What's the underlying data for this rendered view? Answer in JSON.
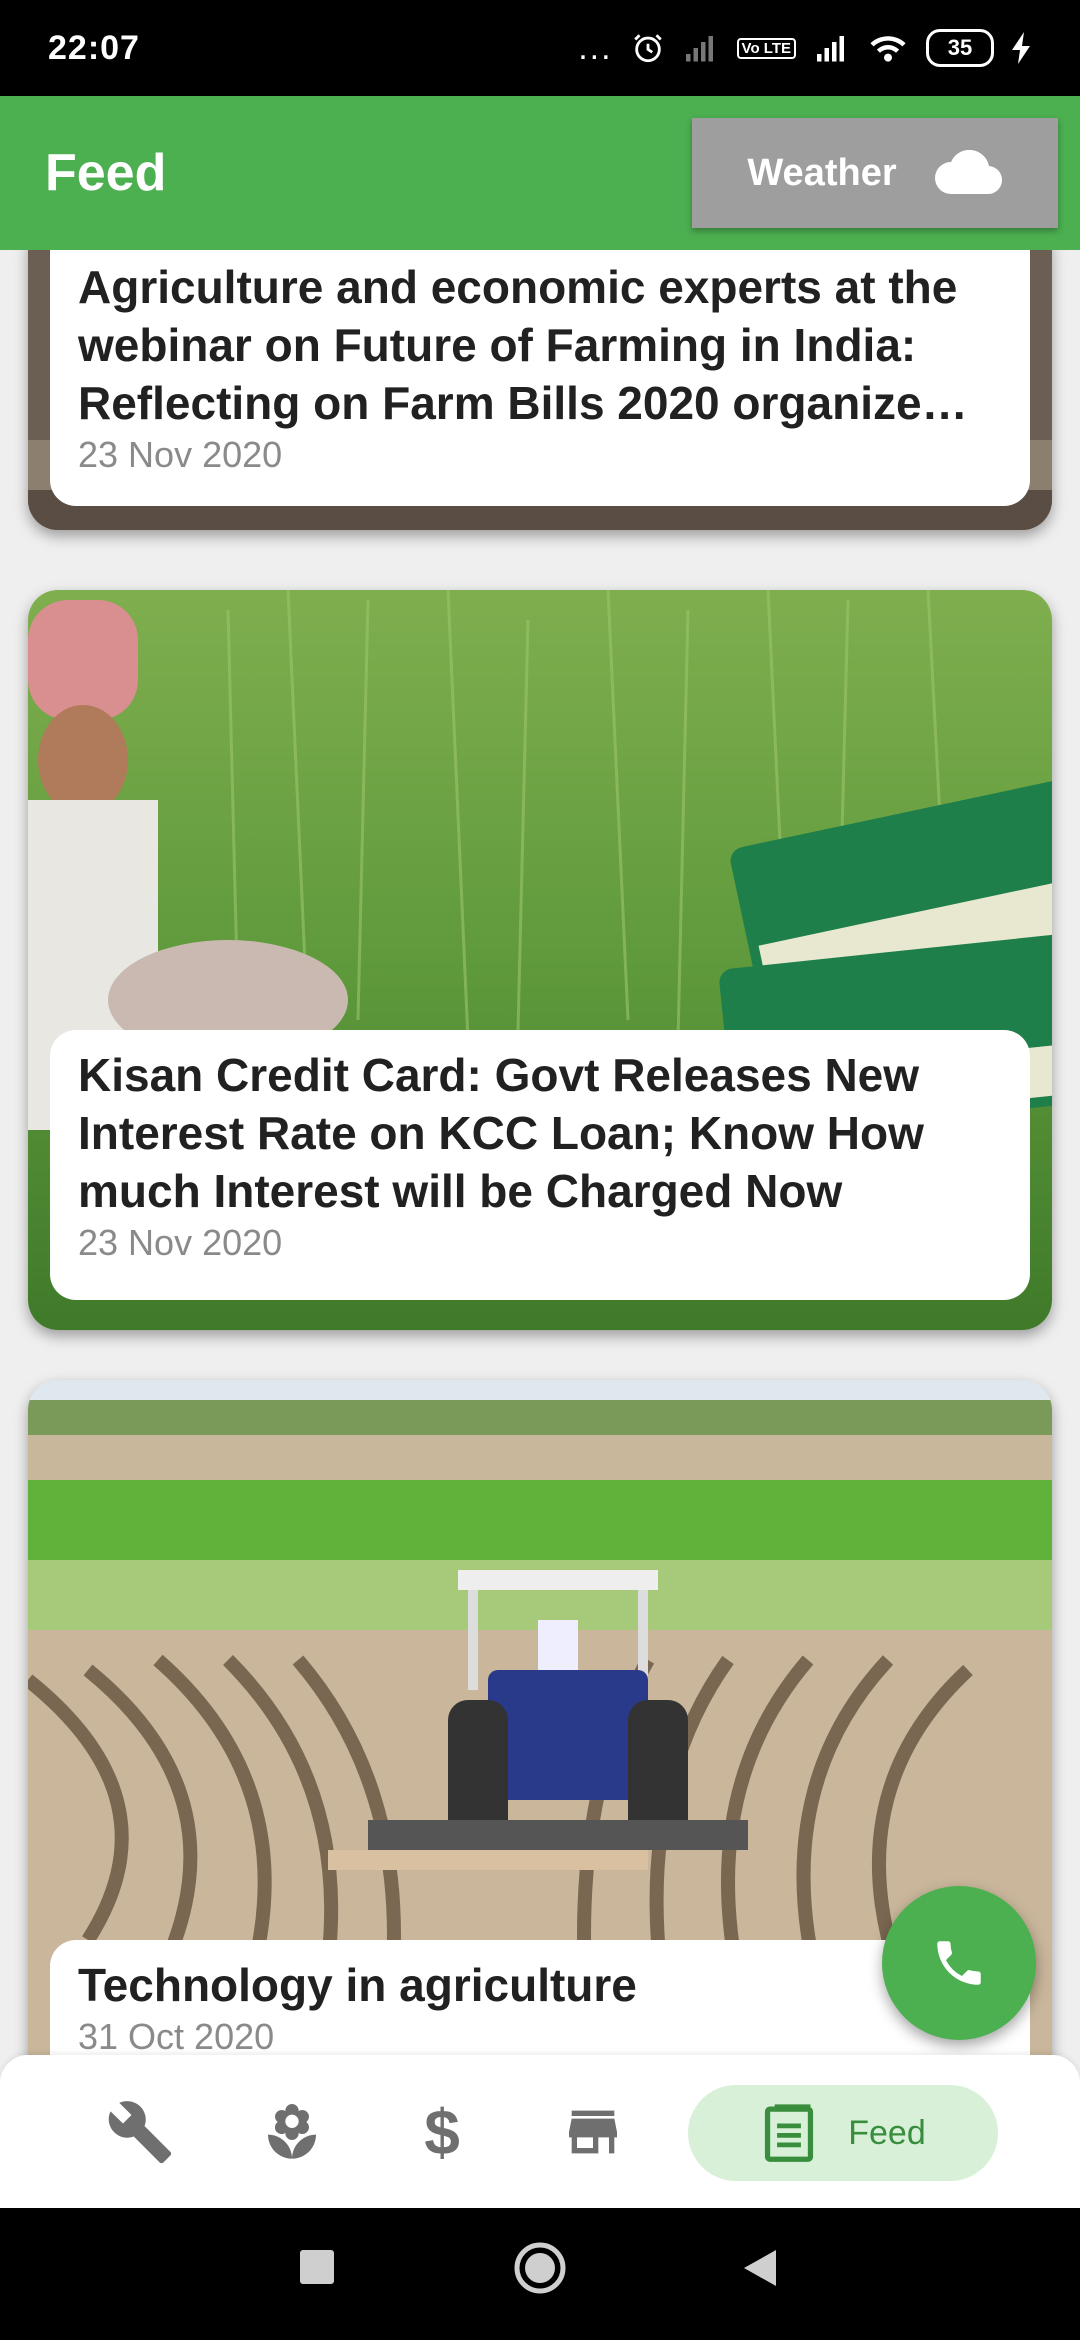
{
  "status_bar": {
    "time": "22:07",
    "dots": "...",
    "lte_label": "Vo LTE",
    "battery": "35"
  },
  "app_bar": {
    "title": "Feed",
    "weather_label": "Weather"
  },
  "feed": {
    "items": [
      {
        "headline": "Agriculture and economic experts at the webinar on Future of Farming in India: Reflecting on Farm Bills 2020 organize…",
        "date": "23 Nov 2020"
      },
      {
        "headline": "Kisan Credit Card: Govt Releases New Interest Rate on KCC Loan; Know How much Interest will be Charged Now",
        "date": "23 Nov 2020"
      },
      {
        "headline": "Technology in agriculture",
        "date": "31 Oct 2020"
      }
    ]
  },
  "bottom_nav": {
    "items": [
      {
        "icon": "wrench-icon"
      },
      {
        "icon": "flower-icon"
      },
      {
        "icon": "dollar-icon",
        "symbol": "$"
      },
      {
        "icon": "store-icon"
      },
      {
        "icon": "feed-icon",
        "label": "Feed",
        "active": true
      }
    ]
  },
  "colors": {
    "primary": "#4caf50",
    "weather_button": "#9e9e9e",
    "active_nav_bg": "#d8f0d8",
    "active_nav_text": "#388e3c"
  }
}
